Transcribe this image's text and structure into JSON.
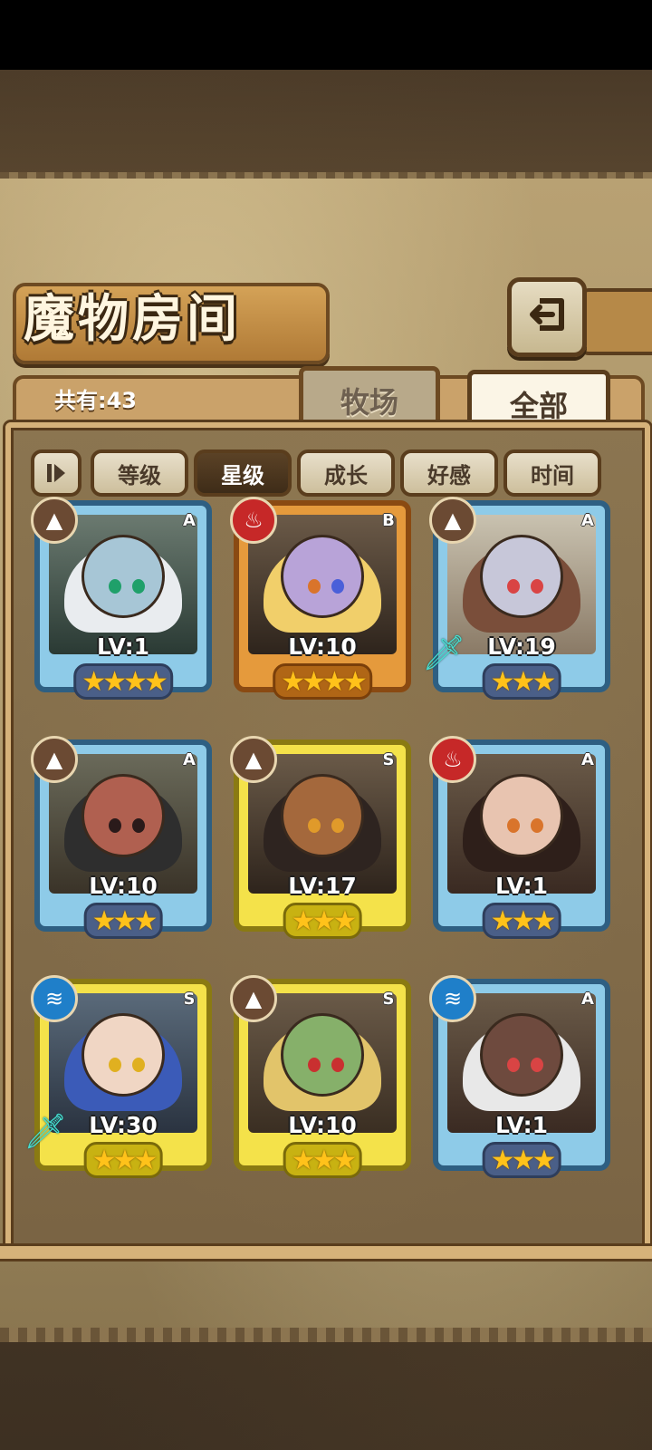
{
  "header": {
    "title": "魔物房间"
  },
  "icons": {
    "back": "back-arrow-icon",
    "sort_toggle": "sort-order-icon",
    "sword": "sword-icon"
  },
  "summary": {
    "total": "共有:43"
  },
  "tabs": [
    {
      "label": "牧场",
      "selected": false
    },
    {
      "label": "全部",
      "selected": true
    }
  ],
  "sort_buttons": [
    {
      "label": "等级",
      "active": false
    },
    {
      "label": "星级",
      "active": true
    },
    {
      "label": "成长",
      "active": false
    },
    {
      "label": "好感",
      "active": false
    },
    {
      "label": "时间",
      "active": false
    }
  ],
  "monsters": [
    {
      "level": "LV:1",
      "rank": "A",
      "element": "earth",
      "stars": "★★★★",
      "equipped": false
    },
    {
      "level": "LV:10",
      "rank": "B",
      "element": "fire",
      "stars": "★★★★",
      "equipped": false
    },
    {
      "level": "LV:19",
      "rank": "A",
      "element": "earth",
      "stars": "★★★",
      "equipped": true
    },
    {
      "level": "LV:10",
      "rank": "A",
      "element": "earth",
      "stars": "★★★",
      "equipped": false
    },
    {
      "level": "LV:17",
      "rank": "S",
      "element": "earth",
      "stars": "★★★",
      "equipped": false
    },
    {
      "level": "LV:1",
      "rank": "A",
      "element": "fire",
      "stars": "★★★",
      "equipped": false
    },
    {
      "level": "LV:30",
      "rank": "S",
      "element": "water",
      "stars": "★★★",
      "equipped": true
    },
    {
      "level": "LV:10",
      "rank": "S",
      "element": "earth",
      "stars": "★★★",
      "equipped": false
    },
    {
      "level": "LV:1",
      "rank": "A",
      "element": "water",
      "stars": "★★★",
      "equipped": false
    }
  ]
}
